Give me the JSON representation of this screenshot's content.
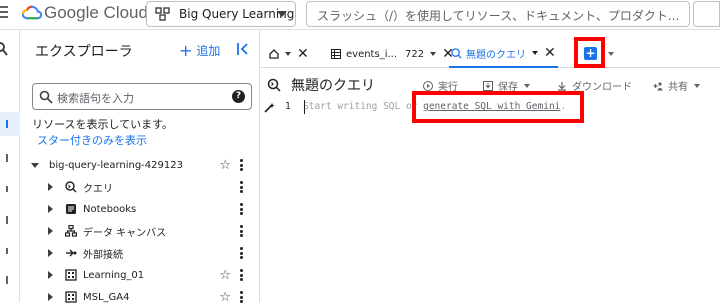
{
  "header": {
    "logo_google": "Google",
    "logo_cloud": " Cloud",
    "project_name": "Big Query Learning",
    "search_placeholder": "スラッシュ（/）を使用してリソース、ドキュメント、プロダクト..."
  },
  "explorer": {
    "title": "エクスプローラ",
    "add_label": "追加",
    "search_placeholder": "検索語句を入力",
    "status_text": "リソースを表示しています。",
    "starred_link": "スター付きのみを表示",
    "tree": [
      {
        "label": "big-query-learning-429123",
        "icon": "project-icon",
        "starred": true
      },
      {
        "label": "クエリ",
        "icon": "query-icon"
      },
      {
        "label": "Notebooks",
        "icon": "notebook-icon"
      },
      {
        "label": "データ キャンバス",
        "icon": "canvas-icon"
      },
      {
        "label": "外部接続",
        "icon": "connection-icon"
      },
      {
        "label": "Learning_01",
        "icon": "dataset-icon",
        "starred": true
      },
      {
        "label": "MSL_GA4",
        "icon": "dataset-icon",
        "starred": true
      }
    ]
  },
  "tabs": [
    {
      "label": "",
      "icon": "home-icon"
    },
    {
      "label": "events_i...",
      "count": "722",
      "icon": "table-icon"
    },
    {
      "label": "無題のクエリ",
      "icon": "query-icon",
      "active": true
    }
  ],
  "toolbar": {
    "title": "無題のクエリ",
    "run_label": "実行",
    "save_label": "保存",
    "download_label": "ダウンロード",
    "share_label": "共有"
  },
  "editor": {
    "line_number": "1",
    "hint_prefix": "Start writing SQL or ",
    "hint_link": "generate SQL with Gemini",
    "hint_suffix": "."
  },
  "colors": {
    "accent": "#1a73e8",
    "highlight": "#ff0000"
  }
}
